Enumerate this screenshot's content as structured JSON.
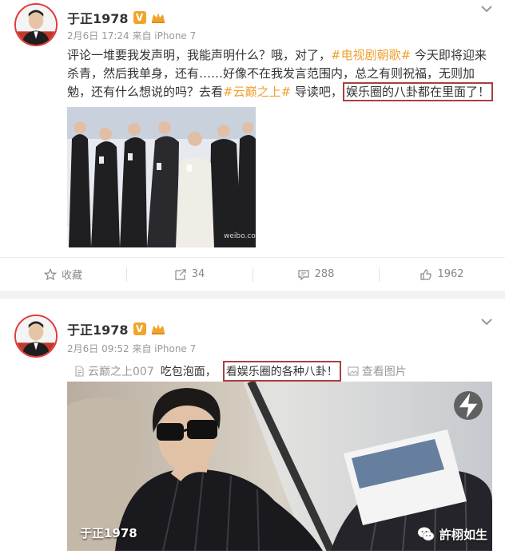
{
  "post1": {
    "author": "于正1978",
    "verified_badge": "V",
    "meta": "2月6日 17:24 来自 iPhone 7",
    "text_before": "评论一堆要我发声明，我能声明什么？哦，对了，",
    "hashtag1": "#电视剧朝歌#",
    "text_middle": " 今天即将迎来杀青，然后我单身，还有……好像不在我发言范围内，总之有则祝福，无则加勉，还有什么想说的吗？去看",
    "hashtag2": "#云巅之上#",
    "text_after": " 导读吧，",
    "highlight": "娱乐圈的八卦都在里面了！",
    "actions": {
      "favorite": "收藏",
      "repost": "34",
      "comment": "288",
      "like": "1962"
    }
  },
  "post2": {
    "author": "于正1978",
    "verified_badge": "V",
    "meta": "2月6日 09:52 来自 iPhone 7",
    "ref_link": "云巅之上007",
    "text": "吃包泡面，",
    "highlight": "看娱乐圈的各种八卦！",
    "view_image": "查看图片",
    "photo_caption": "于正1978"
  },
  "watermark": "許栩如生",
  "colors": {
    "hashtag": "#f0a030",
    "highlight_border": "#a84040",
    "badge": "#f0a42b",
    "avatar_ring": "#e23a3a"
  },
  "icons": [
    "chevron-down-icon",
    "star-icon",
    "repost-icon",
    "comment-icon",
    "like-icon",
    "document-icon",
    "image-icon",
    "flash-icon",
    "wechat-icon",
    "crown-icon"
  ]
}
